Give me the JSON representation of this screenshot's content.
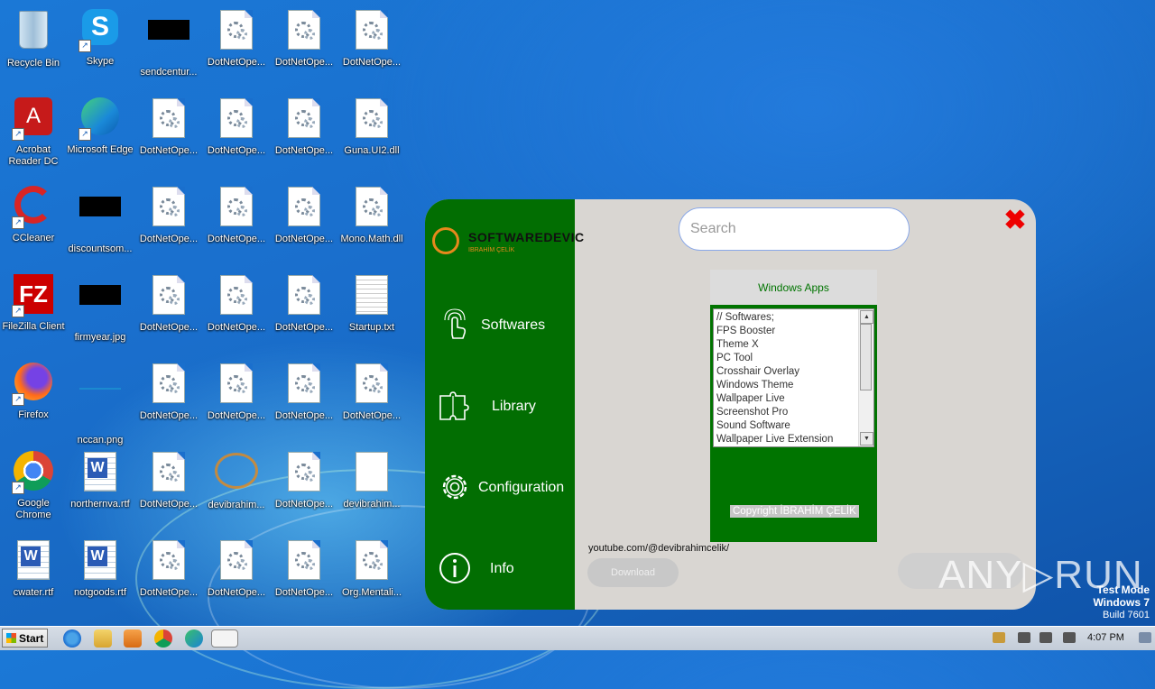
{
  "desktop_icons": [
    {
      "label": "Recycle Bin",
      "kind": "recycle"
    },
    {
      "label": "Skype",
      "kind": "skype"
    },
    {
      "label": "sendcentur...",
      "kind": "black"
    },
    {
      "label": "DotNetOpe...",
      "kind": "dll"
    },
    {
      "label": "DotNetOpe...",
      "kind": "dll"
    },
    {
      "label": "DotNetOpe...",
      "kind": "dll"
    },
    {
      "label": "Acrobat Reader DC",
      "kind": "acrobat"
    },
    {
      "label": "Microsoft Edge",
      "kind": "edge"
    },
    {
      "label": "DotNetOpe...",
      "kind": "dll"
    },
    {
      "label": "DotNetOpe...",
      "kind": "dll"
    },
    {
      "label": "DotNetOpe...",
      "kind": "dll"
    },
    {
      "label": "Guna.UI2.dll",
      "kind": "dll"
    },
    {
      "label": "CCleaner",
      "kind": "ccleaner"
    },
    {
      "label": "discountsom...",
      "kind": "black"
    },
    {
      "label": "DotNetOpe...",
      "kind": "dll"
    },
    {
      "label": "DotNetOpe...",
      "kind": "dll"
    },
    {
      "label": "DotNetOpe...",
      "kind": "dll"
    },
    {
      "label": "Mono.Math.dll",
      "kind": "dll"
    },
    {
      "label": "FileZilla Client",
      "kind": "filezilla"
    },
    {
      "label": "firmyear.jpg",
      "kind": "black"
    },
    {
      "label": "DotNetOpe...",
      "kind": "dll"
    },
    {
      "label": "DotNetOpe...",
      "kind": "dll"
    },
    {
      "label": "DotNetOpe...",
      "kind": "dll"
    },
    {
      "label": "Startup.txt",
      "kind": "txt"
    },
    {
      "label": "Firefox",
      "kind": "firefox"
    },
    {
      "label": "nccan.png",
      "kind": "blank"
    },
    {
      "label": "DotNetOpe...",
      "kind": "dll"
    },
    {
      "label": "DotNetOpe...",
      "kind": "dll"
    },
    {
      "label": "DotNetOpe...",
      "kind": "dll"
    },
    {
      "label": "DotNetOpe...",
      "kind": "dll"
    },
    {
      "label": "Google Chrome",
      "kind": "chrome"
    },
    {
      "label": "northernva.rtf",
      "kind": "word"
    },
    {
      "label": "DotNetOpe...",
      "kind": "dll"
    },
    {
      "label": "devibrahim...",
      "kind": "logo"
    },
    {
      "label": "DotNetOpe...",
      "kind": "dll"
    },
    {
      "label": "devibrahim...",
      "kind": "doc"
    },
    {
      "label": "cwater.rtf",
      "kind": "word"
    },
    {
      "label": "notgoods.rtf",
      "kind": "word"
    },
    {
      "label": "DotNetOpe...",
      "kind": "dll"
    },
    {
      "label": "DotNetOpe...",
      "kind": "dll"
    },
    {
      "label": "DotNetOpe...",
      "kind": "dll"
    },
    {
      "label": "Org.Mentali...",
      "kind": "dll"
    }
  ],
  "app": {
    "logo_title": "SOFTWAREDEVIC",
    "logo_subtitle": "IBRAHİM ÇELİK",
    "nav": [
      {
        "label": "Softwares",
        "icon": "touch-icon"
      },
      {
        "label": "Library",
        "icon": "puzzle-icon"
      },
      {
        "label": "Configuration",
        "icon": "gear-icon"
      },
      {
        "label": "Info",
        "icon": "info-icon"
      }
    ],
    "close_glyph": "✖",
    "search_placeholder": "Search",
    "panel_title": "Windows Apps",
    "list_items": [
      "// Softwares;",
      "FPS Booster",
      "Theme X",
      "PC Tool",
      "Crosshair Overlay",
      "Windows Theme",
      "Wallpaper Live",
      "Screenshot Pro",
      "Sound Software",
      "Wallpaper Live Extension"
    ],
    "copyright": "Copyright İBRAHİM ÇELİK",
    "youtube": "youtube.com/@devibrahimcelik/",
    "download_label": "Download",
    "colors": {
      "sidebar": "#026e02",
      "accent": "#e6891c",
      "panel": "#007400",
      "close": "#e00000"
    }
  },
  "taskbar": {
    "start_label": "Start",
    "clock": "4:07 PM"
  },
  "watermark": "ANY▷RUN",
  "test_mode": {
    "line1": "Test Mode",
    "line2": "Windows 7",
    "line3": "Build 7601"
  }
}
